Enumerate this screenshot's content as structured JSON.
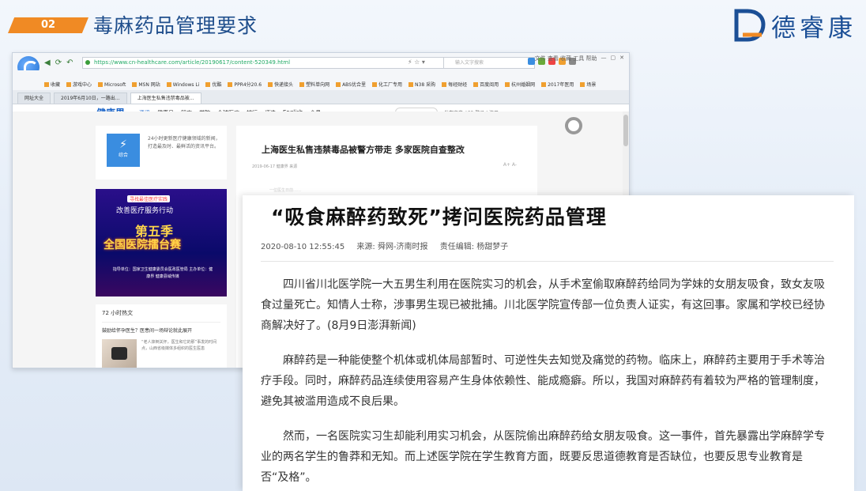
{
  "slide": {
    "section_no": "02",
    "section_title": "毒麻药品管理要求",
    "brand_name": "德睿康"
  },
  "browser": {
    "url": "https://www.cn-healthcare.com/article/20190617/content-520349.html",
    "search_placeholder": "输入文字搜索",
    "menu_bar": "文件  查看  收藏  工具  帮助",
    "favorites": [
      "收藏",
      "游戏中心",
      "Microsoft",
      "MSN 网站",
      "Windows Li",
      "优酷",
      "PPR4分20.6",
      "快递接头",
      "塑料单向网",
      "ABS优合里",
      "化工厂专用",
      "N38 采购",
      "每经财经",
      "百度阅用",
      "杭州婚姻网",
      "2017年医用",
      "场景"
    ],
    "tabs": [
      "网址大全",
      "2019年6月10日，一路出…",
      "上海医生私售违禁毒品被…"
    ],
    "site": {
      "logo": "健康界",
      "nav": [
        "资讯",
        "健康号",
        "智库",
        "学院",
        "全球医疗",
        "排行",
        "评选",
        "English",
        "会员"
      ],
      "right_links": "发布文章  APP  登录 | 注册",
      "news_box_label": "综合",
      "news_box_text": "24小时更新医疗健康领域的新闻，打造最及时、最鲜活的资讯平台。",
      "banner": {
        "tag": "寻找最佳医疗实践",
        "line1": "改善医疗服务行动",
        "line2": "第五季",
        "line3": "全国医院擂台赛",
        "footer": "指导单位：国家卫生健康委员会医政医管局  主办单位：健康界 健康县域传媒"
      },
      "hot": {
        "title": "72 小时热文",
        "headline": "鼓励给怀孕医生？医患间一场辩论就此展开",
        "summary": "“老人摔倒关怀，医生和它的那”事发的时间点，山西省级媒体多组织的医生医患"
      },
      "article": {
        "title": "上海医生私售违禁毒品被警方带走 多家医院自查整改",
        "meta": "2019-06-17  健康界 来源",
        "tools": "A+  A-",
        "faint_line": "一位医生日前……"
      }
    }
  },
  "card": {
    "title": "“吸食麻醉药致死”拷问医院药品管理",
    "date": "2020-08-10 12:55:45",
    "source": "来源: 舜网-济南时报",
    "editor": "责任编辑: 杨甜梦子",
    "paragraphs": [
      "四川省川北医学院一大五男生利用在医院实习的机会，从手术室偷取麻醉药给同为学妹的女朋友吸食，致女友吸食过量死亡。知情人士称，涉事男生现已被批捕。川北医学院宣传部一位负责人证实，有这回事。家属和学校已经协商解决好了。(8月9日澎湃新闻)",
      "麻醉药是一种能使整个机体或机体局部暂时、可逆性失去知觉及痛觉的药物。临床上，麻醉药主要用于手术等治疗手段。同时，麻醉药品连续使用容易产生身体依赖性、能成瘾癖。所以，我国对麻醉药有着较为严格的管理制度，避免其被滥用造成不良后果。",
      "然而，一名医院实习生却能利用实习机会，从医院偷出麻醉药给女朋友吸食。这一事件，首先暴露出学麻醉学专业的两名学生的鲁莽和无知。而上述医学院在学生教育方面，既要反思道德教育是否缺位，也要反思专业教育是否“及格”。"
    ]
  },
  "colors": {
    "accent": "#f08a24",
    "title_blue": "#1f4e8c",
    "brand_blue": "#1b4f96"
  }
}
